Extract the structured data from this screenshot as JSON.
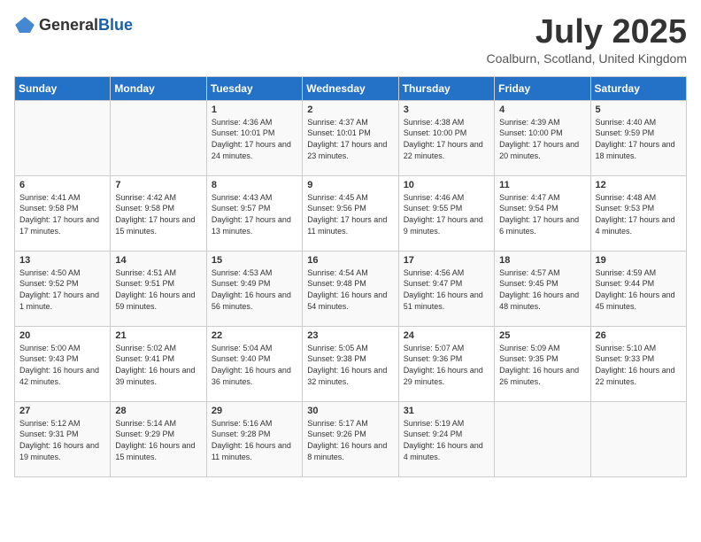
{
  "header": {
    "logo_general": "General",
    "logo_blue": "Blue",
    "month_title": "July 2025",
    "location": "Coalburn, Scotland, United Kingdom"
  },
  "weekdays": [
    "Sunday",
    "Monday",
    "Tuesday",
    "Wednesday",
    "Thursday",
    "Friday",
    "Saturday"
  ],
  "weeks": [
    [
      {
        "day": "",
        "content": ""
      },
      {
        "day": "",
        "content": ""
      },
      {
        "day": "1",
        "content": "Sunrise: 4:36 AM\nSunset: 10:01 PM\nDaylight: 17 hours and 24 minutes."
      },
      {
        "day": "2",
        "content": "Sunrise: 4:37 AM\nSunset: 10:01 PM\nDaylight: 17 hours and 23 minutes."
      },
      {
        "day": "3",
        "content": "Sunrise: 4:38 AM\nSunset: 10:00 PM\nDaylight: 17 hours and 22 minutes."
      },
      {
        "day": "4",
        "content": "Sunrise: 4:39 AM\nSunset: 10:00 PM\nDaylight: 17 hours and 20 minutes."
      },
      {
        "day": "5",
        "content": "Sunrise: 4:40 AM\nSunset: 9:59 PM\nDaylight: 17 hours and 18 minutes."
      }
    ],
    [
      {
        "day": "6",
        "content": "Sunrise: 4:41 AM\nSunset: 9:58 PM\nDaylight: 17 hours and 17 minutes."
      },
      {
        "day": "7",
        "content": "Sunrise: 4:42 AM\nSunset: 9:58 PM\nDaylight: 17 hours and 15 minutes."
      },
      {
        "day": "8",
        "content": "Sunrise: 4:43 AM\nSunset: 9:57 PM\nDaylight: 17 hours and 13 minutes."
      },
      {
        "day": "9",
        "content": "Sunrise: 4:45 AM\nSunset: 9:56 PM\nDaylight: 17 hours and 11 minutes."
      },
      {
        "day": "10",
        "content": "Sunrise: 4:46 AM\nSunset: 9:55 PM\nDaylight: 17 hours and 9 minutes."
      },
      {
        "day": "11",
        "content": "Sunrise: 4:47 AM\nSunset: 9:54 PM\nDaylight: 17 hours and 6 minutes."
      },
      {
        "day": "12",
        "content": "Sunrise: 4:48 AM\nSunset: 9:53 PM\nDaylight: 17 hours and 4 minutes."
      }
    ],
    [
      {
        "day": "13",
        "content": "Sunrise: 4:50 AM\nSunset: 9:52 PM\nDaylight: 17 hours and 1 minute."
      },
      {
        "day": "14",
        "content": "Sunrise: 4:51 AM\nSunset: 9:51 PM\nDaylight: 16 hours and 59 minutes."
      },
      {
        "day": "15",
        "content": "Sunrise: 4:53 AM\nSunset: 9:49 PM\nDaylight: 16 hours and 56 minutes."
      },
      {
        "day": "16",
        "content": "Sunrise: 4:54 AM\nSunset: 9:48 PM\nDaylight: 16 hours and 54 minutes."
      },
      {
        "day": "17",
        "content": "Sunrise: 4:56 AM\nSunset: 9:47 PM\nDaylight: 16 hours and 51 minutes."
      },
      {
        "day": "18",
        "content": "Sunrise: 4:57 AM\nSunset: 9:45 PM\nDaylight: 16 hours and 48 minutes."
      },
      {
        "day": "19",
        "content": "Sunrise: 4:59 AM\nSunset: 9:44 PM\nDaylight: 16 hours and 45 minutes."
      }
    ],
    [
      {
        "day": "20",
        "content": "Sunrise: 5:00 AM\nSunset: 9:43 PM\nDaylight: 16 hours and 42 minutes."
      },
      {
        "day": "21",
        "content": "Sunrise: 5:02 AM\nSunset: 9:41 PM\nDaylight: 16 hours and 39 minutes."
      },
      {
        "day": "22",
        "content": "Sunrise: 5:04 AM\nSunset: 9:40 PM\nDaylight: 16 hours and 36 minutes."
      },
      {
        "day": "23",
        "content": "Sunrise: 5:05 AM\nSunset: 9:38 PM\nDaylight: 16 hours and 32 minutes."
      },
      {
        "day": "24",
        "content": "Sunrise: 5:07 AM\nSunset: 9:36 PM\nDaylight: 16 hours and 29 minutes."
      },
      {
        "day": "25",
        "content": "Sunrise: 5:09 AM\nSunset: 9:35 PM\nDaylight: 16 hours and 26 minutes."
      },
      {
        "day": "26",
        "content": "Sunrise: 5:10 AM\nSunset: 9:33 PM\nDaylight: 16 hours and 22 minutes."
      }
    ],
    [
      {
        "day": "27",
        "content": "Sunrise: 5:12 AM\nSunset: 9:31 PM\nDaylight: 16 hours and 19 minutes."
      },
      {
        "day": "28",
        "content": "Sunrise: 5:14 AM\nSunset: 9:29 PM\nDaylight: 16 hours and 15 minutes."
      },
      {
        "day": "29",
        "content": "Sunrise: 5:16 AM\nSunset: 9:28 PM\nDaylight: 16 hours and 11 minutes."
      },
      {
        "day": "30",
        "content": "Sunrise: 5:17 AM\nSunset: 9:26 PM\nDaylight: 16 hours and 8 minutes."
      },
      {
        "day": "31",
        "content": "Sunrise: 5:19 AM\nSunset: 9:24 PM\nDaylight: 16 hours and 4 minutes."
      },
      {
        "day": "",
        "content": ""
      },
      {
        "day": "",
        "content": ""
      }
    ]
  ]
}
